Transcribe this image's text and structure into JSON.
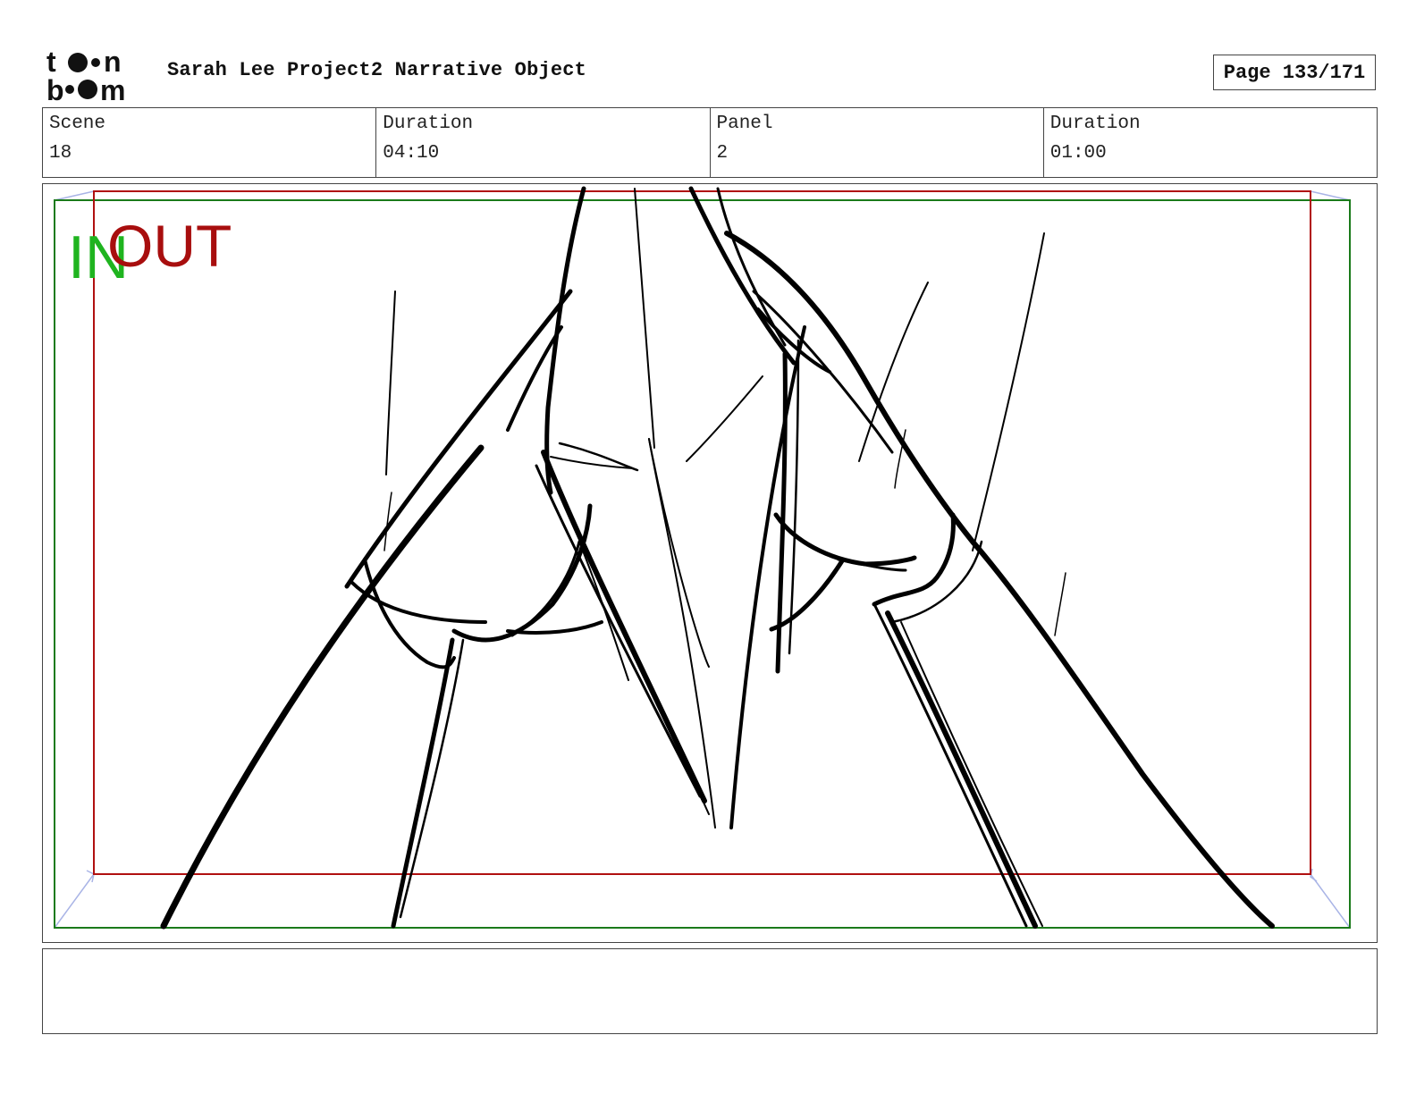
{
  "header": {
    "project_title": "Sarah Lee Project2 Narrative Object",
    "page_label": "Page",
    "page_number": "133/171"
  },
  "logo": {
    "icon": "toon-boom-logo-icon"
  },
  "info": {
    "scene_label": "Scene",
    "scene_value": "18",
    "scene_duration_label": "Duration",
    "scene_duration_value": "04:10",
    "panel_label": "Panel",
    "panel_value": "2",
    "panel_duration_label": "Duration",
    "panel_duration_value": "01:00"
  },
  "panel": {
    "in_label": "IN",
    "out_label": "OUT",
    "colors": {
      "in_frame": "#1a7a1a",
      "in_text": "#1fb41f",
      "out_frame": "#b01010",
      "out_text": "#a80e0e",
      "camera_arrows": "#a9b4e6",
      "sketch": "#000000"
    }
  },
  "notes": {
    "text": ""
  }
}
